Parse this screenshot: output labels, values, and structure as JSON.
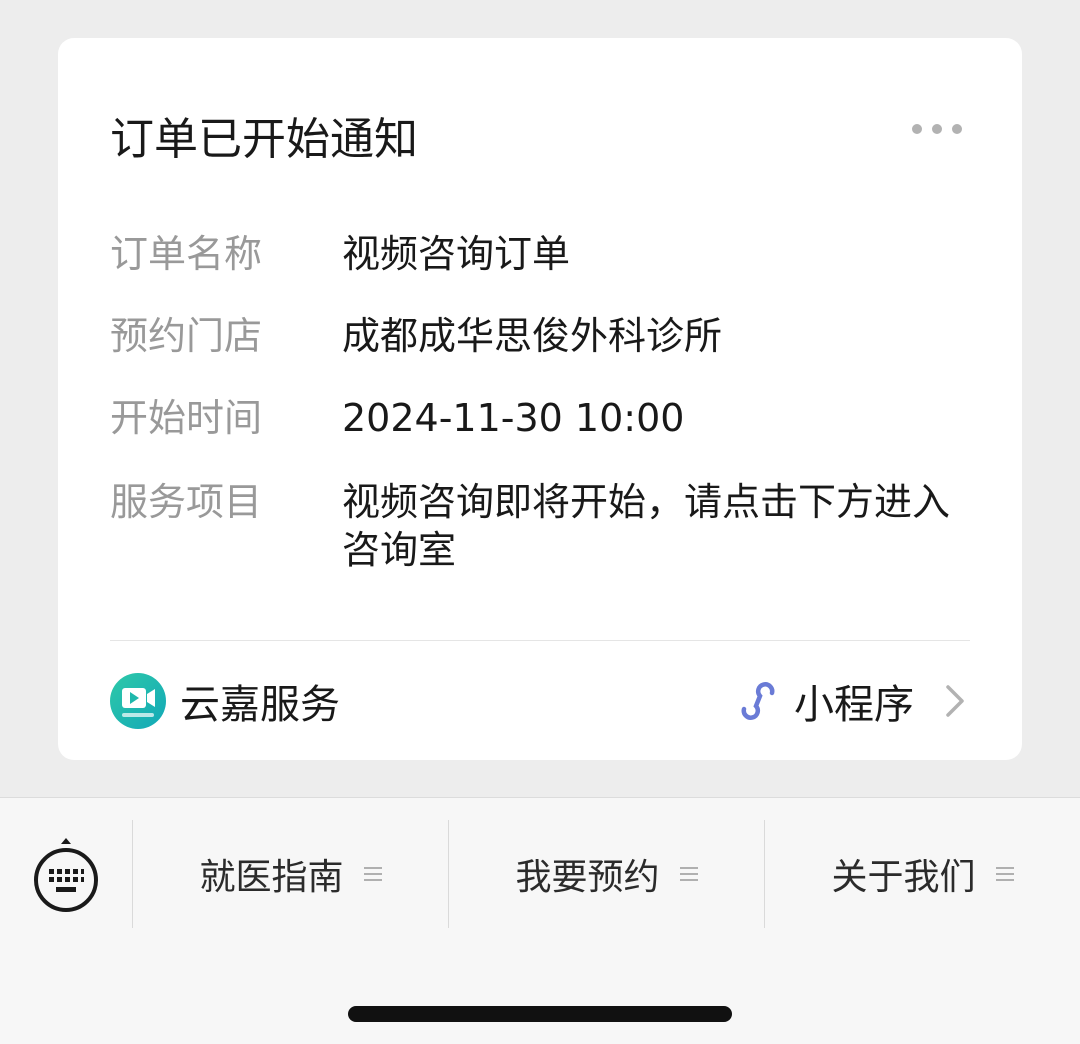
{
  "card": {
    "title": "订单已开始通知",
    "rows": [
      {
        "label": "订单名称",
        "value": "视频咨询订单"
      },
      {
        "label": "预约门店",
        "value": "成都成华思俊外科诊所"
      },
      {
        "label": "开始时间",
        "value": "2024-11-30 10:00"
      },
      {
        "label": "服务项目",
        "value": "视频咨询即将开始，请点击下方进入咨询室"
      }
    ],
    "footer": {
      "app_name": "云嘉服务",
      "app_logo_icon": "video-camera-icon",
      "mini_program_label": "小程序",
      "mini_program_icon": "mini-program-link-icon"
    }
  },
  "menu": {
    "keyboard_icon": "keyboard-icon",
    "items": [
      {
        "label": "就医指南",
        "icon": "menu-lines-icon"
      },
      {
        "label": "我要预约",
        "icon": "menu-lines-icon"
      },
      {
        "label": "关于我们",
        "icon": "menu-lines-icon"
      }
    ]
  },
  "colors": {
    "background": "#ededed",
    "card": "#ffffff",
    "label_gray": "#999999",
    "text": "#191919",
    "mini_program_accent": "#6a7bd6",
    "logo_teal": "#1fb8ac"
  }
}
